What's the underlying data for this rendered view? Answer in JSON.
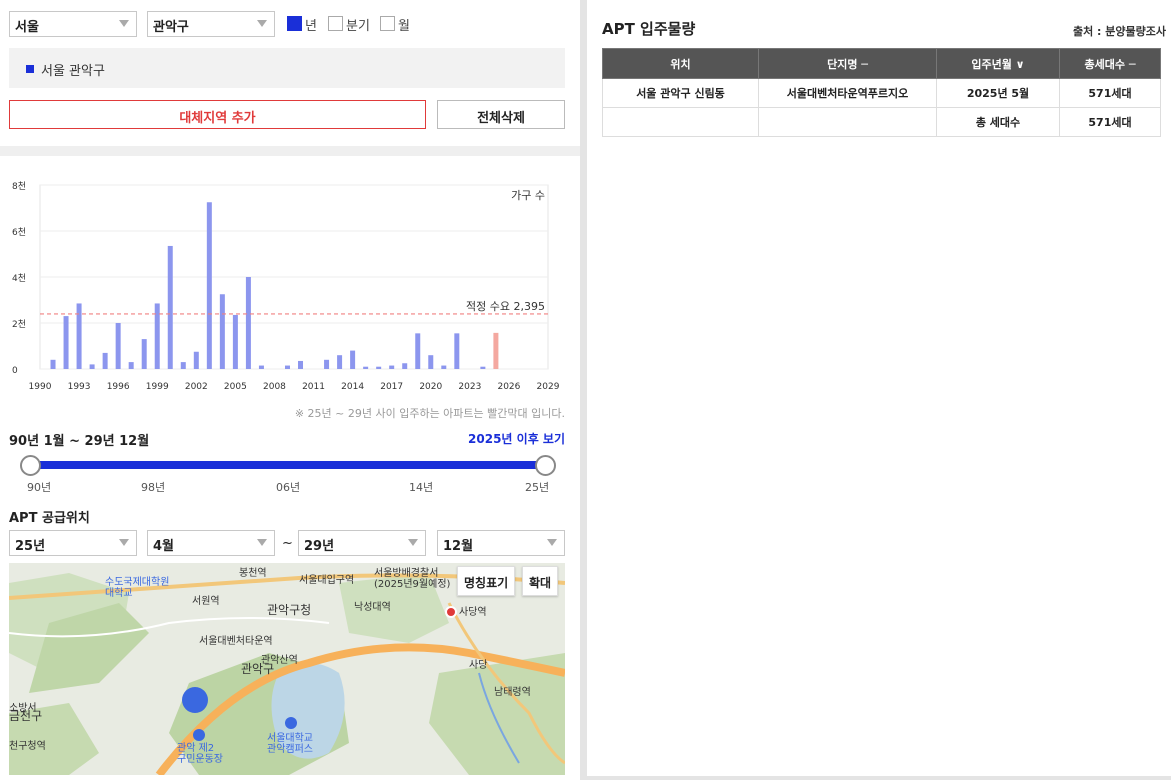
{
  "filters": {
    "city": "서울",
    "district": "관악구",
    "period_options": [
      {
        "label": "년",
        "checked": true
      },
      {
        "label": "분기",
        "checked": false
      },
      {
        "label": "월",
        "checked": false
      }
    ]
  },
  "region_list": [
    "서울 관악구"
  ],
  "buttons": {
    "add_region": "대체지역 추가",
    "delete_all": "전체삭제"
  },
  "chart_data": {
    "type": "bar",
    "series_label": "가구 수",
    "y_ticks": [
      "8천",
      "6천",
      "4천",
      "2천",
      "0"
    ],
    "x_ticks": [
      "1990",
      "1993",
      "1996",
      "1999",
      "2002",
      "2005",
      "2008",
      "2011",
      "2014",
      "2017",
      "2020",
      "2023",
      "2026",
      "2029"
    ],
    "ylim": [
      0,
      8000
    ],
    "xlim": [
      1990,
      2029
    ],
    "reference_line": {
      "label": "적정 수요 2,395",
      "value": 2395
    },
    "bars": [
      {
        "year": 1991,
        "value": 400
      },
      {
        "year": 1992,
        "value": 2300
      },
      {
        "year": 1993,
        "value": 2850
      },
      {
        "year": 1994,
        "value": 200
      },
      {
        "year": 1995,
        "value": 700
      },
      {
        "year": 1996,
        "value": 2000
      },
      {
        "year": 1997,
        "value": 300
      },
      {
        "year": 1998,
        "value": 1300
      },
      {
        "year": 1999,
        "value": 2850
      },
      {
        "year": 2000,
        "value": 5350
      },
      {
        "year": 2001,
        "value": 300
      },
      {
        "year": 2002,
        "value": 750
      },
      {
        "year": 2003,
        "value": 7250
      },
      {
        "year": 2004,
        "value": 3250
      },
      {
        "year": 2005,
        "value": 2350
      },
      {
        "year": 2006,
        "value": 4000
      },
      {
        "year": 2007,
        "value": 150
      },
      {
        "year": 2009,
        "value": 150
      },
      {
        "year": 2010,
        "value": 350
      },
      {
        "year": 2012,
        "value": 400
      },
      {
        "year": 2013,
        "value": 600
      },
      {
        "year": 2014,
        "value": 800
      },
      {
        "year": 2015,
        "value": 100
      },
      {
        "year": 2016,
        "value": 100
      },
      {
        "year": 2017,
        "value": 150
      },
      {
        "year": 2018,
        "value": 250
      },
      {
        "year": 2019,
        "value": 1550
      },
      {
        "year": 2020,
        "value": 600
      },
      {
        "year": 2021,
        "value": 150
      },
      {
        "year": 2022,
        "value": 1550
      },
      {
        "year": 2024,
        "value": 100
      },
      {
        "year": 2025,
        "value": 1571,
        "highlight": true
      }
    ],
    "colors": {
      "normal": "#8c96ee",
      "highlight": "#f4a8a0",
      "reference": "#f08080"
    }
  },
  "chart_note": "※ 25년 ~ 29년 사이 입주하는 아파트는 빨간막대 입니다.",
  "range": {
    "label": "90년 1월 ~ 29년 12월",
    "link": "2025년 이후 보기",
    "ticks": [
      "90년",
      "98년",
      "06년",
      "14년",
      "25년"
    ]
  },
  "supply": {
    "title": "APT 공급위치",
    "from_year": "25년",
    "from_month": "4월",
    "tilde": "~",
    "to_year": "29년",
    "to_month": "12월"
  },
  "map": {
    "btn_label": "명칭표기",
    "btn_zoom": "확대",
    "labels": {
      "univ": "수도국제대학원\n대학교",
      "bongcheon": "봉천역",
      "seouldae_ipgu": "서울대입구역",
      "police": "서울방배경찰서\n(2025년9월예정)",
      "seowon": "서원역",
      "gwanak_office": "관악구청",
      "nakseongdae": "낙성대역",
      "sadang": "사당역",
      "seouldae_venture": "서울대벤처타운역",
      "gwanaksan": "관악산역",
      "gwanakgu": "관악구",
      "sadang_ic": "사당",
      "namtaeryeong": "남태령역",
      "sobangseo": "소방서",
      "geumcheon": "금천구",
      "gwanak2": "관악 제2\n구민운동장",
      "snu": "서울대학교\n관악캠퍼스",
      "guchung": "천구청역"
    }
  },
  "right": {
    "title": "APT 입주물량",
    "source": "출처 : 분양물량조사",
    "columns": [
      "위치",
      "단지명 ─",
      "입주년월 ∨",
      "총세대수 ─"
    ],
    "rows": [
      [
        "서울 관악구 신림동",
        "서울대벤처타운역푸르지오",
        "2025년 5월",
        "571세대"
      ],
      [
        "",
        "",
        "총 세대수",
        "571세대"
      ]
    ]
  }
}
